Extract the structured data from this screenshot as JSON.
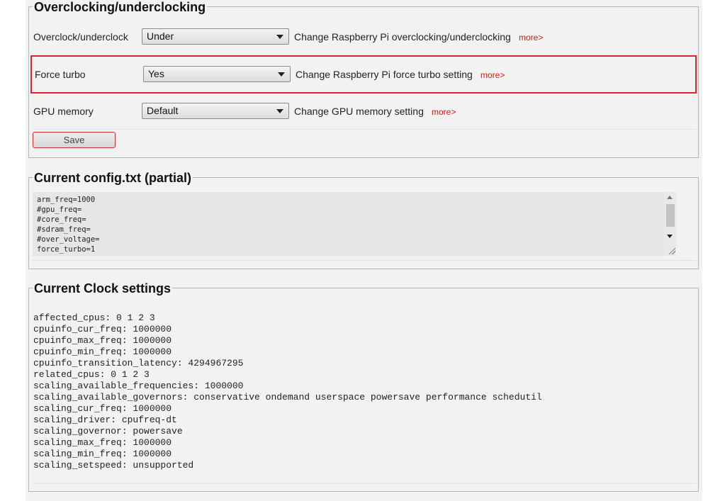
{
  "overclock_section": {
    "legend": "Overclocking/underclocking",
    "rows": [
      {
        "label": "Overclock/underclock",
        "value": "Under",
        "description": "Change Raspberry Pi overclocking/underclocking",
        "more": "more>"
      },
      {
        "label": "Force turbo",
        "value": "Yes",
        "description": "Change Raspberry Pi force turbo setting",
        "more": "more>"
      },
      {
        "label": "GPU memory",
        "value": "Default",
        "description": "Change GPU memory setting",
        "more": "more>"
      }
    ],
    "save_label": "Save"
  },
  "config_section": {
    "legend": "Current config.txt (partial)",
    "text": "arm_freq=1000\n#gpu_freq=\n#core_freq=\n#sdram_freq=\n#over_voltage=\nforce_turbo=1"
  },
  "clock_section": {
    "legend": "Current Clock settings",
    "lines": [
      "affected_cpus: 0 1 2 3",
      "cpuinfo_cur_freq: 1000000",
      "cpuinfo_max_freq: 1000000",
      "cpuinfo_min_freq: 1000000",
      "cpuinfo_transition_latency: 4294967295",
      "related_cpus: 0 1 2 3",
      "scaling_available_frequencies: 1000000",
      "scaling_available_governors: conservative ondemand userspace powersave performance schedutil",
      "scaling_cur_freq: 1000000",
      "scaling_driver: cpufreq-dt",
      "scaling_governor: powersave",
      "scaling_max_freq: 1000000",
      "scaling_min_freq: 1000000",
      "scaling_setspeed: unsupported"
    ]
  },
  "colors": {
    "accent_red": "#d62828",
    "link_red": "#d01818",
    "panel_bg": "#f2f2f2"
  }
}
